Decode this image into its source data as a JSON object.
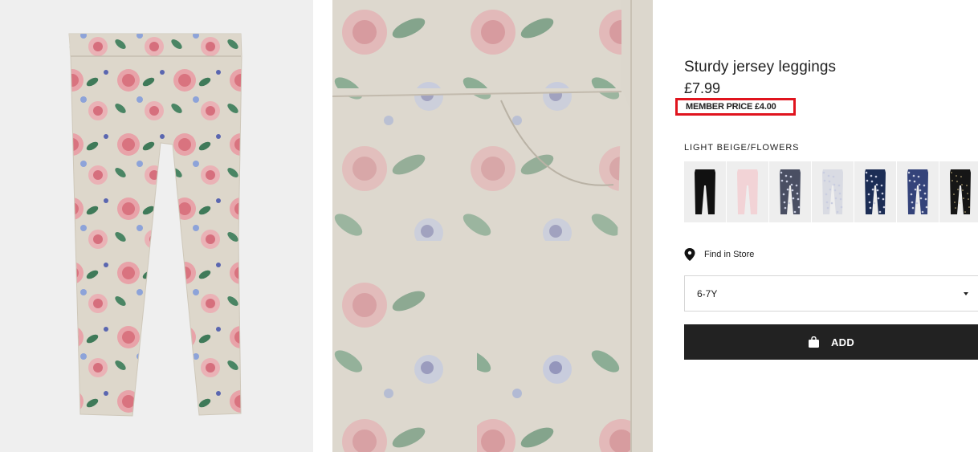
{
  "product": {
    "title": "Sturdy jersey leggings",
    "price": "£7.99",
    "member_price": "MEMBER PRICE £4.00",
    "color_name": "LIGHT BEIGE/FLOWERS"
  },
  "images": [
    {
      "icon": "product-photo-full-leggings"
    },
    {
      "icon": "product-photo-detail-closeup"
    }
  ],
  "swatches": [
    {
      "color": "#111111",
      "pattern": "solid"
    },
    {
      "color": "#f2d3d6",
      "pattern": "solid"
    },
    {
      "color": "#4a4f63",
      "pattern": "print"
    },
    {
      "color": "#d9dbe3",
      "pattern": "print"
    },
    {
      "color": "#1c2d55",
      "pattern": "print"
    },
    {
      "color": "#34437a",
      "pattern": "print"
    },
    {
      "color": "#161616",
      "pattern": "dots"
    }
  ],
  "store": {
    "label": "Find in Store",
    "icon": "location-pin-icon"
  },
  "size_select": {
    "selected": "6-7Y"
  },
  "add_button": {
    "label": "ADD",
    "icon": "shopping-bag-icon"
  },
  "colors": {
    "member_outline": "#e0141e",
    "button_bg": "#222222"
  }
}
